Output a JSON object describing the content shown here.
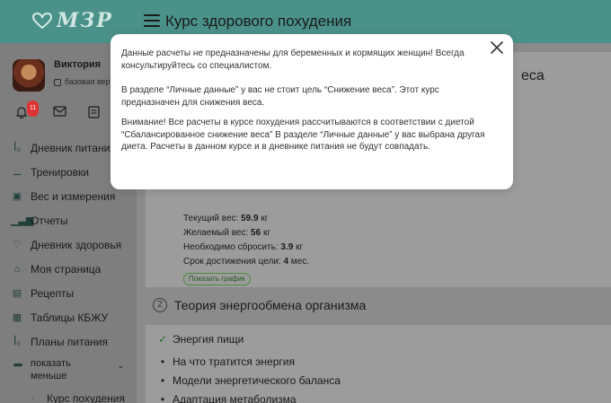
{
  "header": {
    "logo_text": "МЗР",
    "title": "Курс здорового похудения"
  },
  "profile": {
    "name": "Виктория",
    "plan": "базовая вер",
    "notifications_count": "11"
  },
  "sidebar": {
    "items": [
      {
        "label": "Дневник питания",
        "icon": "cutlery-icon"
      },
      {
        "label": "Тренировки",
        "icon": "dumbbell-icon"
      },
      {
        "label": "Вес и измерения",
        "icon": "scale-icon"
      },
      {
        "label": "Отчеты",
        "icon": "bar-chart-icon"
      },
      {
        "label": "Дневник здоровья",
        "icon": "heart-pulse-icon"
      },
      {
        "label": "Моя страница",
        "icon": "home-icon"
      },
      {
        "label": "Рецепты",
        "icon": "clipboard-icon"
      },
      {
        "label": "Таблицы КБЖУ",
        "icon": "table-icon"
      },
      {
        "label": "Планы питания",
        "icon": "cutlery-icon"
      }
    ],
    "more_label_1": "показать",
    "more_label_2": "меньше",
    "last_item": "Курс похудения"
  },
  "main": {
    "bg_title_fragment": "еса",
    "stats": {
      "current_label": "Текущий вес: ",
      "current_value": "59.9",
      "current_unit": " кг",
      "desired_label": "Желаемый вес: ",
      "desired_value": "56",
      "desired_unit": " кг",
      "need_label": "Необходимо сбросить: ",
      "need_value": "3.9",
      "need_unit": " кг",
      "deadline_label": "Срок достижения цели: ",
      "deadline_value": "4",
      "deadline_unit": " мес."
    },
    "chart_button": "Показать график",
    "section2_num": "2",
    "section2_title": "Теория энергообмена организма",
    "list": [
      "Энергия пищи",
      "На что тратится энергия",
      "Модели энергетического баланса",
      "Адаптация метаболизма"
    ]
  },
  "modal": {
    "p1": "Данные расчеты не предназначены для беременных и кормящих женщин! Всегда консультируйтесь со специалистом.",
    "p2": "В разделе “Личные данные” у вас не стоит цель “Снижение веса”. Этот курс предназначен для снижения веса.",
    "p3": "Внимание! Все расчеты в курсе похудения рассчитываются в соответствии с диетой “Сбалансированное снижение веса” В разделе “Личные данные” у вас выбрана другая диета. Расчеты в данном курсе и в дневнике питания не будут совпадать."
  }
}
